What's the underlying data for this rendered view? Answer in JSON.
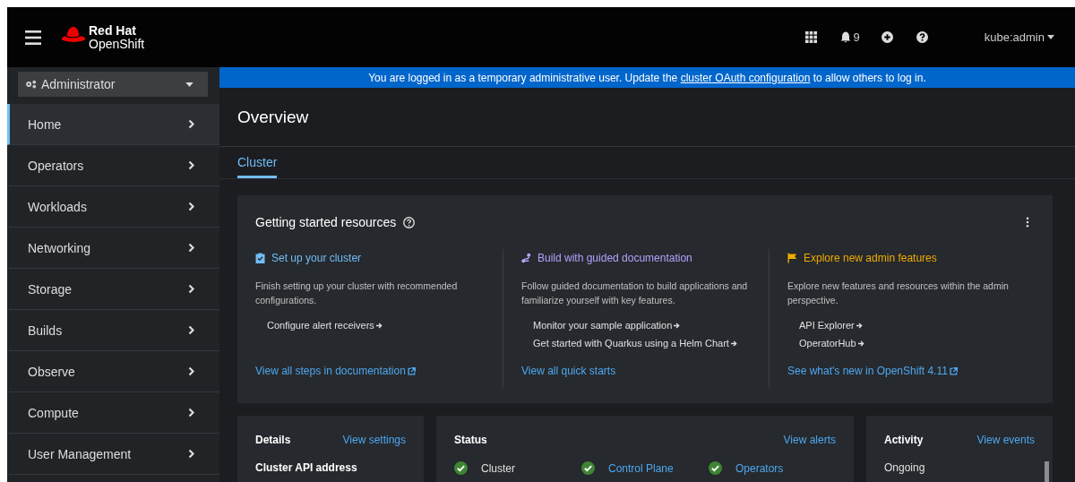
{
  "masthead": {
    "brand_top": "Red Hat",
    "brand_bottom": "OpenShift",
    "notifications": "9",
    "user": "kube:admin"
  },
  "perspective": {
    "label": "Administrator"
  },
  "sidebar": {
    "items": [
      {
        "label": "Home",
        "selected": true
      },
      {
        "label": "Operators",
        "selected": false
      },
      {
        "label": "Workloads",
        "selected": false
      },
      {
        "label": "Networking",
        "selected": false
      },
      {
        "label": "Storage",
        "selected": false
      },
      {
        "label": "Builds",
        "selected": false
      },
      {
        "label": "Observe",
        "selected": false
      },
      {
        "label": "Compute",
        "selected": false
      },
      {
        "label": "User Management",
        "selected": false
      }
    ]
  },
  "banner": {
    "before": "You are logged in as a temporary administrative user. Update the",
    "link": "cluster OAuth configuration",
    "after": "to allow others to log in."
  },
  "page": {
    "title": "Overview",
    "tabs": [
      {
        "label": "Cluster",
        "selected": true
      }
    ]
  },
  "getting_started": {
    "title": "Getting started resources",
    "columns": [
      {
        "title": "Set up your cluster",
        "color": "#73bcf7",
        "description": "Finish setting up your cluster with recommended configurations.",
        "links": [
          "Configure alert receivers"
        ],
        "footer": "View all steps in documentation",
        "external": true
      },
      {
        "title": "Build with guided documentation",
        "color": "#b2a3ff",
        "description": "Follow guided documentation to build applications and familiarize yourself with key features.",
        "links": [
          "Monitor your sample application",
          "Get started with Quarkus using a Helm Chart"
        ],
        "footer": "View all quick starts",
        "external": false
      },
      {
        "title": "Explore new admin features",
        "color": "#f0ab00",
        "description": "Explore new features and resources within the admin perspective.",
        "links": [
          "API Explorer",
          "OperatorHub"
        ],
        "footer": "See what's new in OpenShift 4.11",
        "external": true
      }
    ]
  },
  "details": {
    "title": "Details",
    "action": "View settings",
    "field": "Cluster API address"
  },
  "status": {
    "title": "Status",
    "action": "View alerts",
    "items": [
      {
        "label": "Cluster",
        "link": false
      },
      {
        "label": "Control Plane",
        "link": true
      },
      {
        "label": "Operators",
        "link": true
      }
    ]
  },
  "activity": {
    "title": "Activity",
    "action": "View events",
    "section": "Ongoing"
  }
}
